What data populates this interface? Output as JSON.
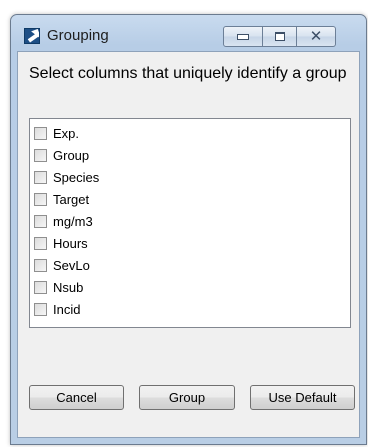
{
  "window": {
    "title": "Grouping",
    "caption_buttons": {
      "minimize": "minimize",
      "maximize": "maximize",
      "close": "close"
    }
  },
  "prompt": "Select columns that uniquely identify a group",
  "columns": [
    {
      "label": "Exp.",
      "checked": false
    },
    {
      "label": "Group",
      "checked": false
    },
    {
      "label": "Species",
      "checked": false
    },
    {
      "label": "Target",
      "checked": false
    },
    {
      "label": "mg/m3",
      "checked": false
    },
    {
      "label": "Hours",
      "checked": false
    },
    {
      "label": "SevLo",
      "checked": false
    },
    {
      "label": "Nsub",
      "checked": false
    },
    {
      "label": "Incid",
      "checked": false
    }
  ],
  "buttons": {
    "cancel": "Cancel",
    "group": "Group",
    "use_default": "Use Default"
  }
}
